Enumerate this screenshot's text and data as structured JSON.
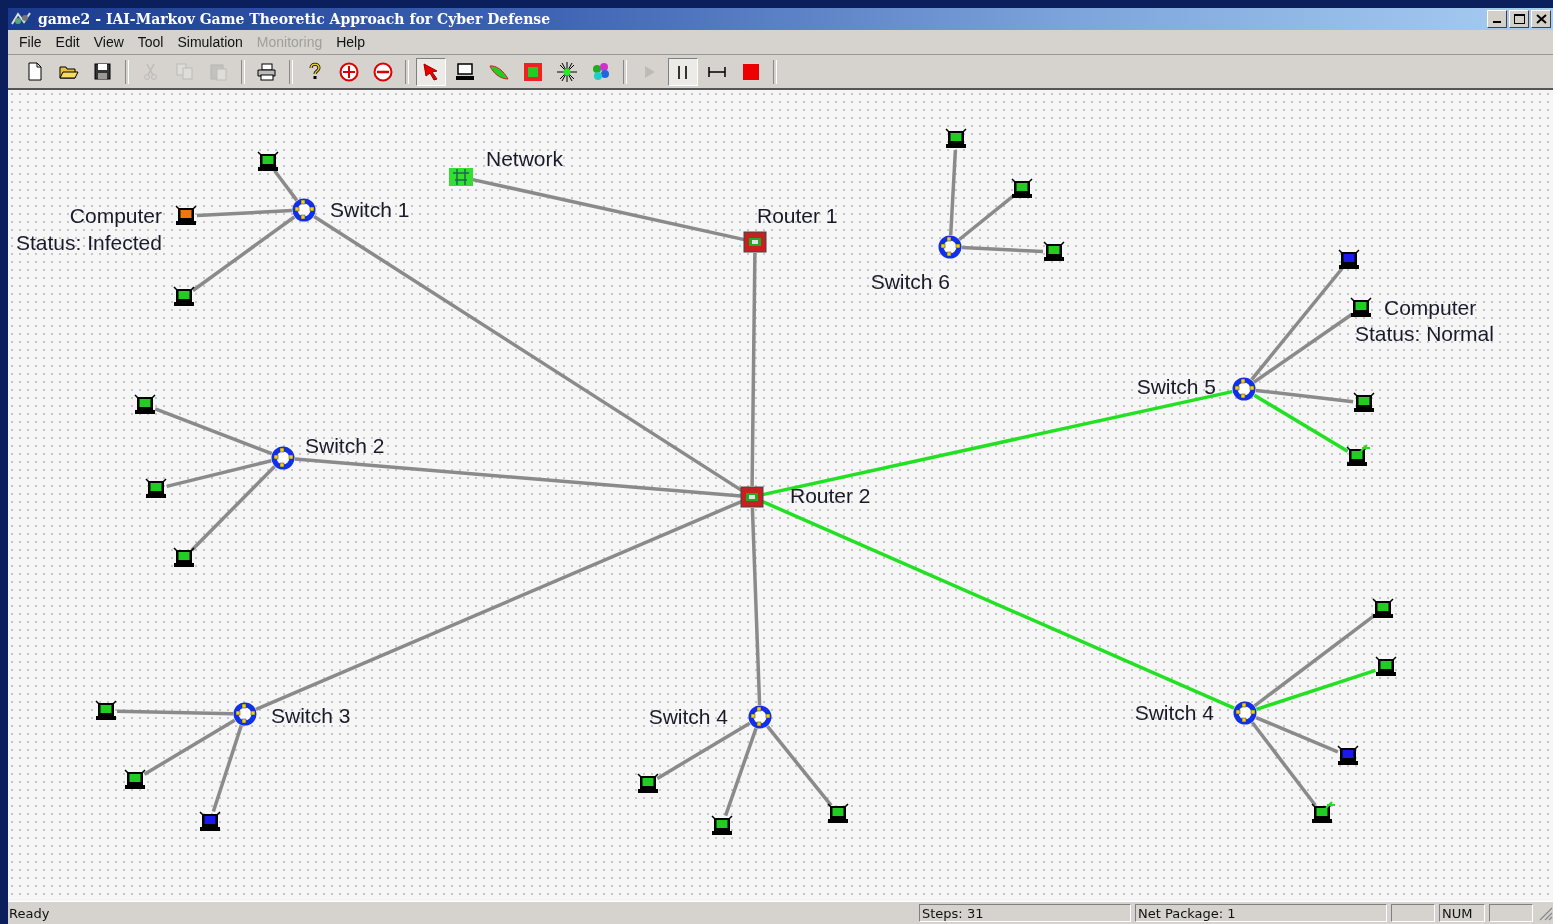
{
  "window": {
    "title": "game2 - IAI-Markov Game Theoretic Approach for Cyber Defense"
  },
  "menu": [
    {
      "label": "File",
      "disabled": false
    },
    {
      "label": "Edit",
      "disabled": false
    },
    {
      "label": "View",
      "disabled": false
    },
    {
      "label": "Tool",
      "disabled": false
    },
    {
      "label": "Simulation",
      "disabled": false
    },
    {
      "label": "Monitoring",
      "disabled": true
    },
    {
      "label": "Help",
      "disabled": false
    }
  ],
  "toolbar": [
    {
      "kind": "new",
      "disabled": false,
      "selected": false
    },
    {
      "kind": "open",
      "disabled": false,
      "selected": false
    },
    {
      "kind": "save",
      "disabled": false,
      "selected": false
    },
    {
      "kind": "separator"
    },
    {
      "kind": "cut",
      "disabled": true,
      "selected": false
    },
    {
      "kind": "copy",
      "disabled": true,
      "selected": false
    },
    {
      "kind": "paste",
      "disabled": true,
      "selected": false
    },
    {
      "kind": "separator"
    },
    {
      "kind": "print",
      "disabled": false,
      "selected": false
    },
    {
      "kind": "separator"
    },
    {
      "kind": "help",
      "disabled": false,
      "selected": false
    },
    {
      "kind": "add",
      "disabled": false,
      "selected": false
    },
    {
      "kind": "remove",
      "disabled": false,
      "selected": false
    },
    {
      "kind": "separator"
    },
    {
      "kind": "pointer",
      "disabled": false,
      "selected": true
    },
    {
      "kind": "computer",
      "disabled": false,
      "selected": false
    },
    {
      "kind": "link",
      "disabled": false,
      "selected": false
    },
    {
      "kind": "router",
      "disabled": false,
      "selected": false
    },
    {
      "kind": "hub",
      "disabled": false,
      "selected": false
    },
    {
      "kind": "network",
      "disabled": false,
      "selected": false
    },
    {
      "kind": "separator"
    },
    {
      "kind": "play",
      "disabled": true,
      "selected": false
    },
    {
      "kind": "pause",
      "disabled": false,
      "selected": true
    },
    {
      "kind": "step",
      "disabled": false,
      "selected": false
    },
    {
      "kind": "stop",
      "disabled": false,
      "selected": false
    },
    {
      "kind": "separator"
    }
  ],
  "nodes": [
    {
      "kind": "network",
      "label": "Network",
      "children": [
        {
          "kind": "router",
          "label": "Router 1",
          "link_active": false,
          "children": [
            {
              "kind": "router",
              "label": "Router 2",
              "link_active": false,
              "children": [
                {
                  "kind": "switch",
                  "label": "Switch 1",
                  "link_active": false,
                  "children": [
                    {
                      "kind": "computer",
                      "color": "#22cc22",
                      "flagged": false,
                      "link_active": false
                    },
                    {
                      "kind": "computer",
                      "label": "Computer",
                      "status": "Status: Infected",
                      "color": "#ee7711",
                      "flagged": false,
                      "link_active": false
                    },
                    {
                      "kind": "computer",
                      "color": "#22cc22",
                      "flagged": false,
                      "link_active": false
                    }
                  ]
                },
                {
                  "kind": "switch",
                  "label": "Switch 2",
                  "link_active": false,
                  "children": [
                    {
                      "kind": "computer",
                      "color": "#22cc22",
                      "flagged": false,
                      "link_active": false
                    },
                    {
                      "kind": "computer",
                      "color": "#22cc22",
                      "flagged": false,
                      "link_active": false
                    },
                    {
                      "kind": "computer",
                      "color": "#22cc22",
                      "flagged": false,
                      "link_active": false
                    }
                  ]
                },
                {
                  "kind": "switch",
                  "label": "Switch 3",
                  "link_active": false,
                  "children": [
                    {
                      "kind": "computer",
                      "color": "#22cc22",
                      "flagged": false,
                      "link_active": false
                    },
                    {
                      "kind": "computer",
                      "color": "#22cc22",
                      "flagged": false,
                      "link_active": false
                    },
                    {
                      "kind": "computer",
                      "color": "#1a1aee",
                      "flagged": false,
                      "link_active": false
                    }
                  ]
                },
                {
                  "kind": "switch",
                  "label": "Switch 4",
                  "link_active": false,
                  "children": [
                    {
                      "kind": "computer",
                      "color": "#22cc22",
                      "flagged": false,
                      "link_active": false
                    },
                    {
                      "kind": "computer",
                      "color": "#22cc22",
                      "flagged": false,
                      "link_active": false
                    },
                    {
                      "kind": "computer",
                      "color": "#22cc22",
                      "flagged": false,
                      "link_active": false
                    }
                  ]
                },
                {
                  "kind": "switch",
                  "label": "Switch 5",
                  "link_active": true,
                  "children": [
                    {
                      "kind": "computer",
                      "color": "#1a1aee",
                      "flagged": false,
                      "link_active": false
                    },
                    {
                      "kind": "computer",
                      "label": "Computer",
                      "status": "Status: Normal",
                      "color": "#22cc22",
                      "flagged": false,
                      "link_active": false
                    },
                    {
                      "kind": "computer",
                      "color": "#22cc22",
                      "flagged": false,
                      "link_active": false
                    },
                    {
                      "kind": "computer",
                      "color": "#22cc22",
                      "flagged": true,
                      "link_active": true
                    }
                  ]
                },
                {
                  "kind": "switch",
                  "label": "Switch 4",
                  "link_active": true,
                  "children": [
                    {
                      "kind": "computer",
                      "color": "#22cc22",
                      "flagged": false,
                      "link_active": false
                    },
                    {
                      "kind": "computer",
                      "color": "#22cc22",
                      "flagged": false,
                      "link_active": true
                    },
                    {
                      "kind": "computer",
                      "color": "#1a1aee",
                      "flagged": false,
                      "link_active": false
                    },
                    {
                      "kind": "computer",
                      "color": "#22cc22",
                      "flagged": true,
                      "link_active": false
                    }
                  ]
                }
              ]
            }
          ]
        }
      ]
    },
    {
      "kind": "switch",
      "label": "Switch 6",
      "children": [
        {
          "kind": "computer",
          "color": "#22cc22",
          "flagged": false,
          "link_active": false
        },
        {
          "kind": "computer",
          "color": "#22cc22",
          "flagged": false,
          "link_active": false
        },
        {
          "kind": "computer",
          "color": "#22cc22",
          "flagged": false,
          "link_active": false
        }
      ]
    }
  ],
  "status_bar": {
    "message": "Ready",
    "panels": [
      {
        "text": "Steps: 31"
      },
      {
        "text": "Net Package: 1"
      },
      {
        "text": "NUM"
      }
    ]
  }
}
